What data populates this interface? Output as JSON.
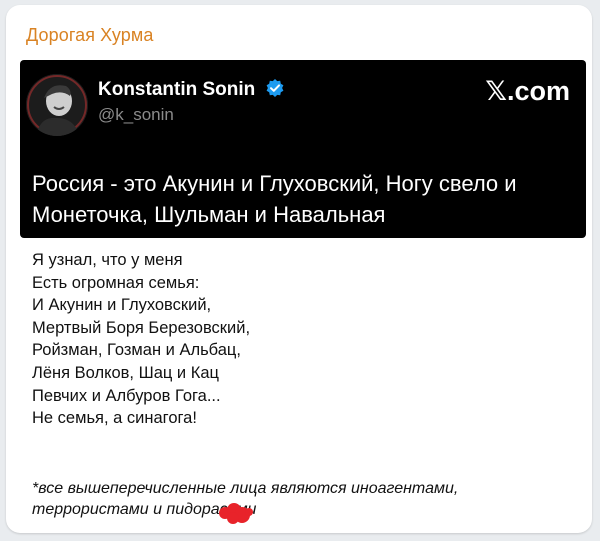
{
  "channel": {
    "name": "Дорогая Хурма"
  },
  "tweet": {
    "author": "Konstantin Sonin",
    "handle": "@k_sonin",
    "brand": "𝕏.com",
    "headline": "Россия - это Акунин и Глуховский, Ногу свело и Монеточка, Шульман и Навальная",
    "icons": {
      "avatar": "avatar-photo",
      "verified": "verified-badge-icon"
    },
    "colors": {
      "background": "#000000",
      "verified": "#1d9bf0"
    }
  },
  "poem": {
    "lines": [
      "Я узнал, что у меня",
      "Есть огромная семья:",
      "И Акунин и Глуховский,",
      "Мертвый Боря Березовский,",
      "Ройзман, Гозман и Альбац,",
      "Лёня Волков, Шац и Кац",
      "Певчих и Албуров Гога...",
      "Не семья, а синагога!"
    ]
  },
  "footnote": {
    "text": "*все вышеперечисленные лица являются иноагентами, террористами и пидорасами"
  },
  "colors": {
    "channel_name": "#d98324",
    "card": "#ffffff",
    "page_bg": "#e9ecef",
    "blot": "#e8232a"
  }
}
